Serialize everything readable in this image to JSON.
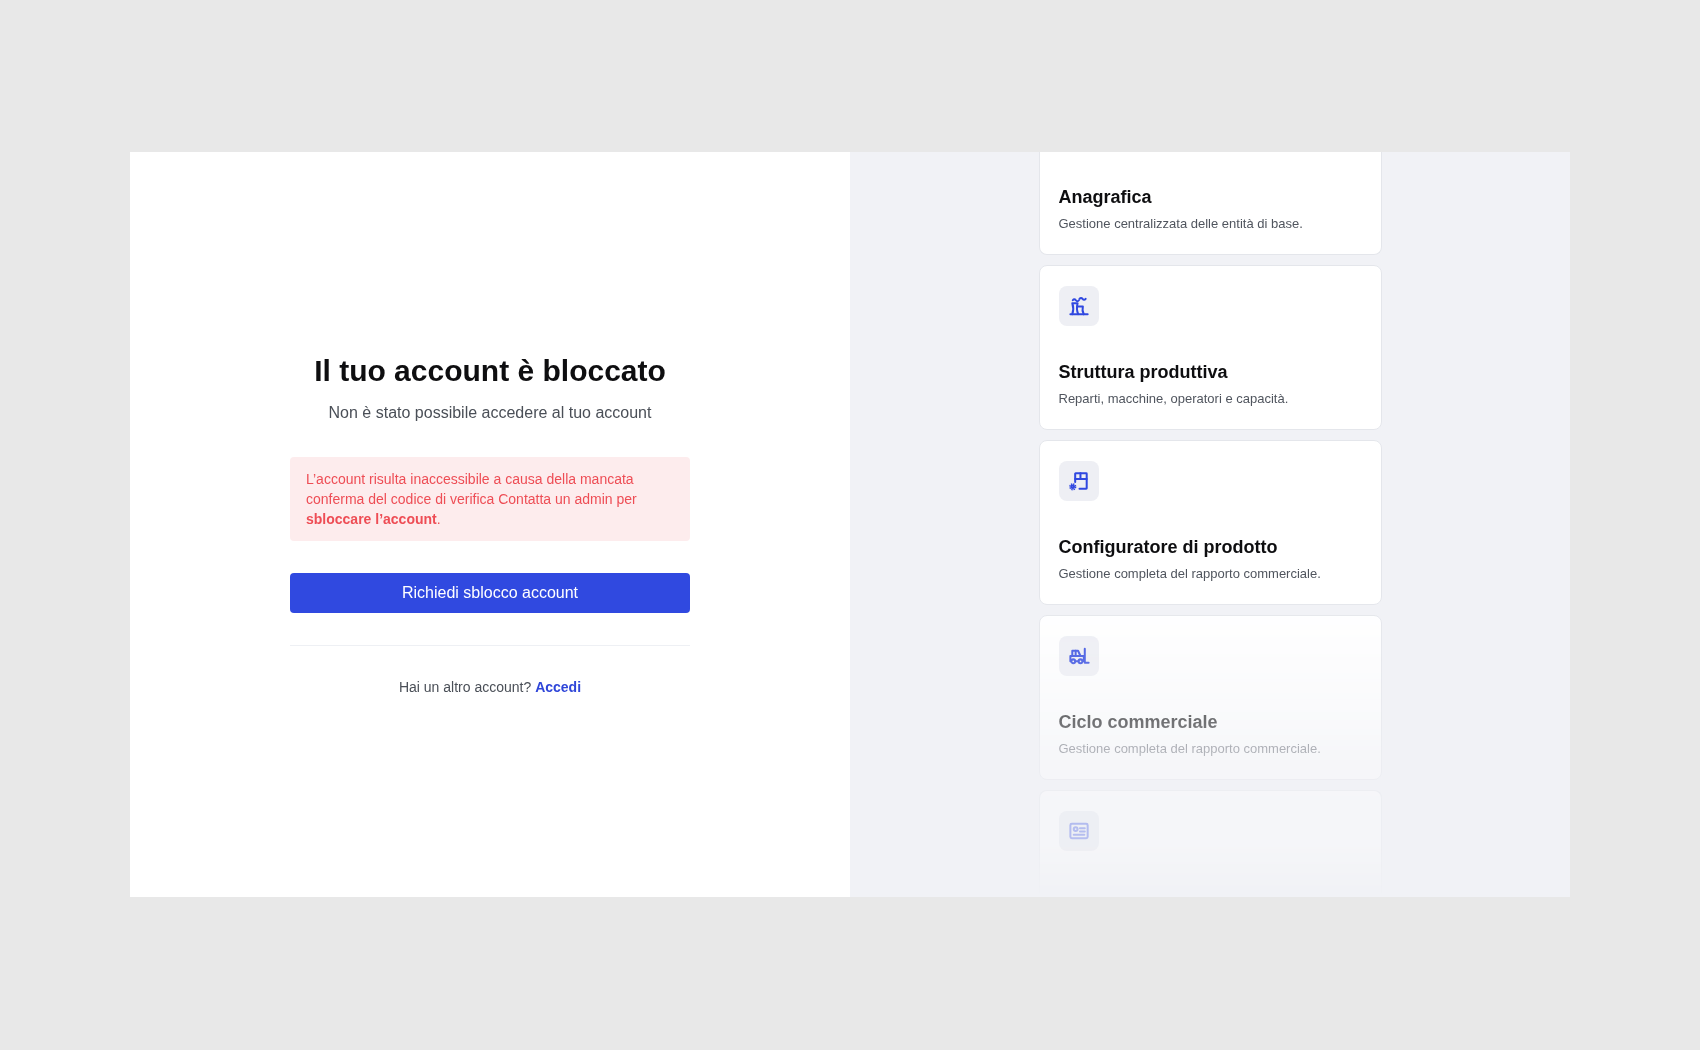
{
  "login_panel": {
    "title": "Il tuo account è bloccato",
    "subtitle": "Non è stato possibile accedere al tuo account",
    "alert": {
      "kind": "error",
      "text": "L’account risulta inaccessibile a causa della mancata conferma del codice di verifica Contatta un admin per **sbloccare l’account**."
    },
    "button": "Richiedi sblocco account",
    "footer": {
      "text": "Hai un altro account?",
      "link": "Accedi"
    }
  },
  "feature_cards": [
    {
      "kind": "cropped",
      "title": "Anagrafica",
      "description": "Gestione centralizzata delle entità di base."
    },
    {
      "kind": "module",
      "title": "Struttura produttiva",
      "description": "Reparti, macchine, operatori e capacità."
    },
    {
      "kind": "module",
      "title": "Configuratore di prodotto",
      "description": "Gestione completa del rapporto commerciale."
    },
    {
      "kind": "module",
      "title": "Ciclo commerciale",
      "description": "Gestione completa del rapporto commerciale."
    },
    {
      "kind": "cropped"
    }
  ]
}
